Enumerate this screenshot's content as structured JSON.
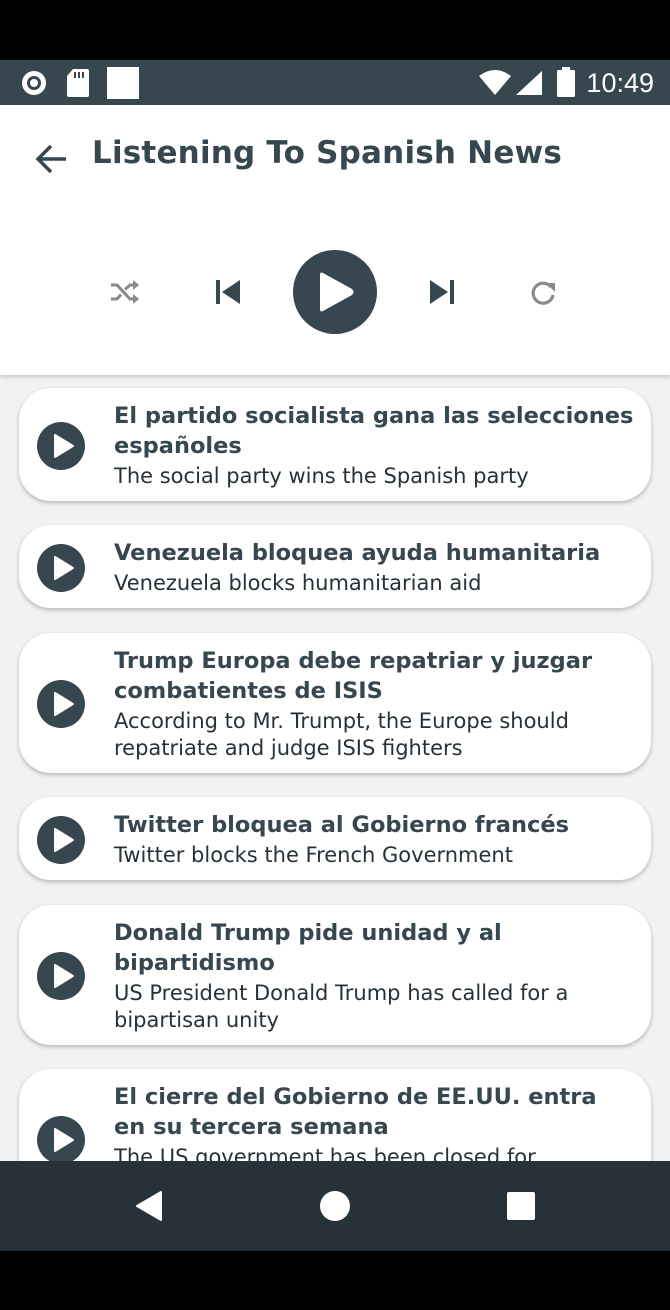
{
  "status_bar": {
    "time": "10:49",
    "icons": [
      "record-icon",
      "sd-card-icon",
      "white-square-icon",
      "wifi-icon",
      "signal-icon",
      "battery-icon"
    ]
  },
  "header": {
    "back_icon": "arrow-back-icon",
    "title": "Listening To Spanish News"
  },
  "controls": {
    "shuffle_icon": "shuffle-icon",
    "previous_icon": "skip-previous-icon",
    "play_icon": "play-icon",
    "next_icon": "skip-next-icon",
    "repeat_icon": "repeat-icon"
  },
  "news_items": [
    {
      "title": "El partido socialista gana las selecciones españoles",
      "translation": "The social party wins the Spanish party"
    },
    {
      "title": "Venezuela bloquea ayuda humanitaria",
      "translation": "Venezuela blocks humanitarian aid"
    },
    {
      "title": "Trump Europa debe repatriar y juzgar combatientes de ISIS",
      "translation": "According to Mr. Trumpt, the Europe should repatriate and judge ISIS fighters"
    },
    {
      "title": "Twitter bloquea al Gobierno francés",
      "translation": "Twitter blocks the French Government"
    },
    {
      "title": "Donald Trump pide unidad y al bipartidismo",
      "translation": "US President Donald Trump has called for a bipartisan unity"
    },
    {
      "title": "El cierre del Gobierno de EE.UU. entra en su tercera semana",
      "translation": "The US government has been closed for"
    }
  ],
  "nav_bar": {
    "back_icon": "nav-back-icon",
    "home_icon": "nav-home-icon",
    "recents_icon": "nav-recents-icon"
  },
  "colors": {
    "primary": "#37474f",
    "status_bar": "#37474f",
    "nav_bar": "#263238",
    "card": "#ffffff",
    "list_background": "#f2f2f2"
  }
}
